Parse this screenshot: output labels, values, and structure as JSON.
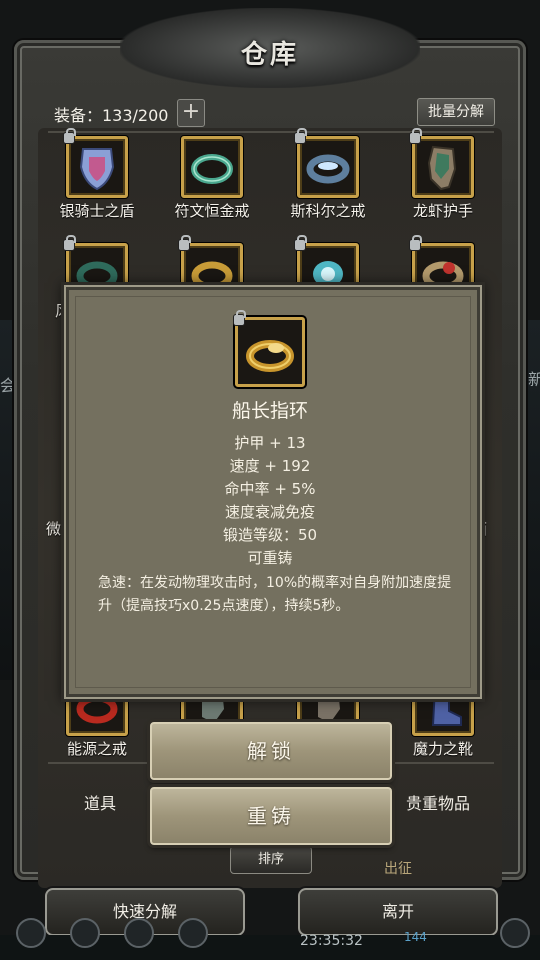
{
  "window": {
    "title": "仓库"
  },
  "equipment": {
    "count_text": "装备：133/200",
    "add_symbol": "+",
    "batch_label": "批量分解"
  },
  "items_row1": [
    {
      "name": "银骑士之盾",
      "icon": "shield-icon"
    },
    {
      "name": "符文恒金戒",
      "icon": "ring-icon"
    },
    {
      "name": "斯科尔之戒",
      "icon": "ring-icon"
    },
    {
      "name": "龙虾护手",
      "icon": "gauntlet-icon"
    }
  ],
  "items_bottom": [
    {
      "name": "能源之戒",
      "icon": "ring-icon"
    },
    {
      "name": "魔力之靴",
      "icon": "boots-icon"
    }
  ],
  "side_chars": {
    "row2_left": "风",
    "left_mid": "微",
    "right_mid": "面",
    "bg_left": "会",
    "bg_right": "新"
  },
  "tabs": {
    "left": "道具",
    "right": "贵重物品"
  },
  "sort_label": "排序",
  "bottom": {
    "quick_decompose": "快速分解",
    "leave": "离开",
    "clock": "23:35:32",
    "level_number": "144",
    "behind_text": "出征"
  },
  "tooltip": {
    "item_name": "船长指环",
    "stats": [
      "护甲 + 13",
      "速度 + 192",
      "命中率 + 5%",
      "速度衰减免疫",
      "锻造等级：50",
      "可重铸"
    ],
    "description": "急速：在发动物理攻击时，10%的概率对自身附加速度提升（提高技巧x0.25点速度），持续5秒。"
  },
  "actions": {
    "unlock": "解锁",
    "recast": "重铸"
  },
  "colors": {
    "gold_border": "#c7a14a",
    "popup_bg": "#74705f",
    "button_bg": "#a59c80"
  }
}
